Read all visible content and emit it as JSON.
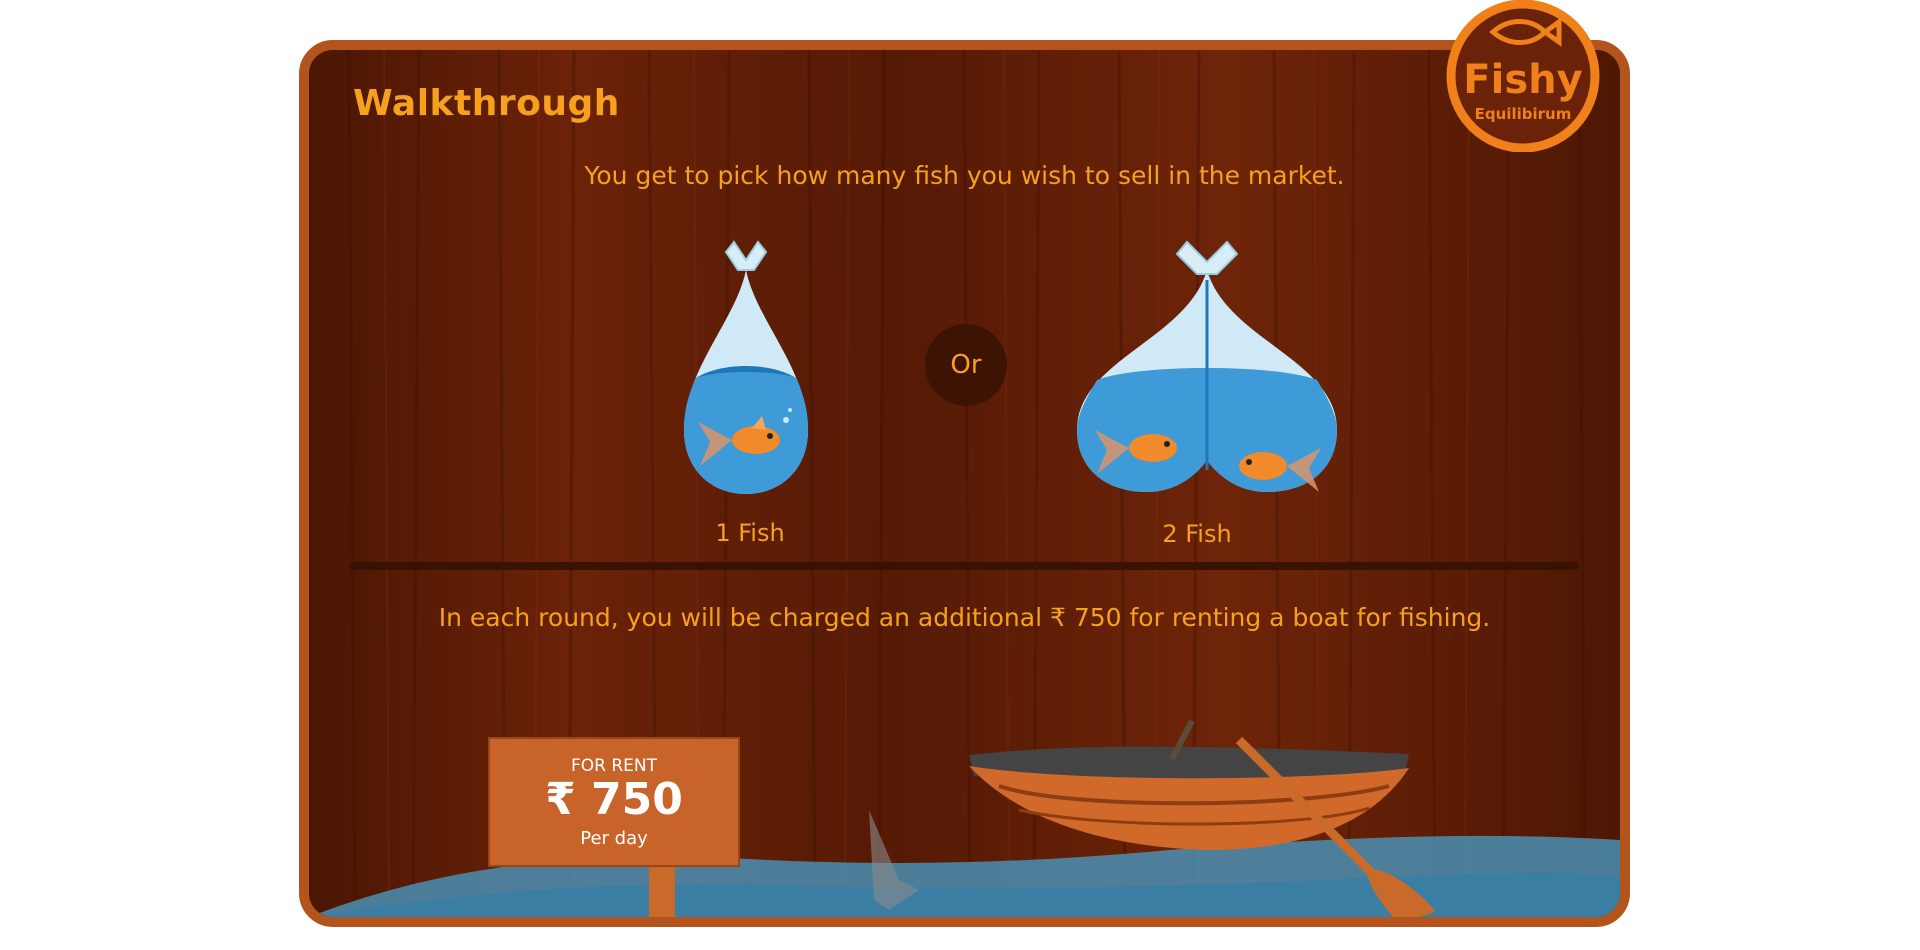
{
  "header": {
    "title": "Walkthrough"
  },
  "intro": {
    "text": "You get to pick how many fish you wish to sell in the market."
  },
  "options": [
    {
      "label": "1 Fish",
      "fish_count": 1
    },
    {
      "label": "2 Fish",
      "fish_count": 2
    }
  ],
  "separator": {
    "label": "Or"
  },
  "rent": {
    "text": "In each round, you will be charged an additional ₹ 750 for renting a boat for fishing.",
    "sign_title": "FOR RENT",
    "sign_price": "₹ 750",
    "sign_unit": "Per day"
  },
  "logo": {
    "title": "Fishy",
    "subtitle": "Equilibirum"
  },
  "colors": {
    "accent": "#f6a11e",
    "wood": "#5c1c05",
    "frame": "#b3541c",
    "water": "#4a8fb4",
    "logo_ring": "#f0801a"
  },
  "icons": [
    "fish-bag-icon",
    "goldfish-icon",
    "fish-logo-icon",
    "boat-icon",
    "oar-icon",
    "sign-icon"
  ]
}
